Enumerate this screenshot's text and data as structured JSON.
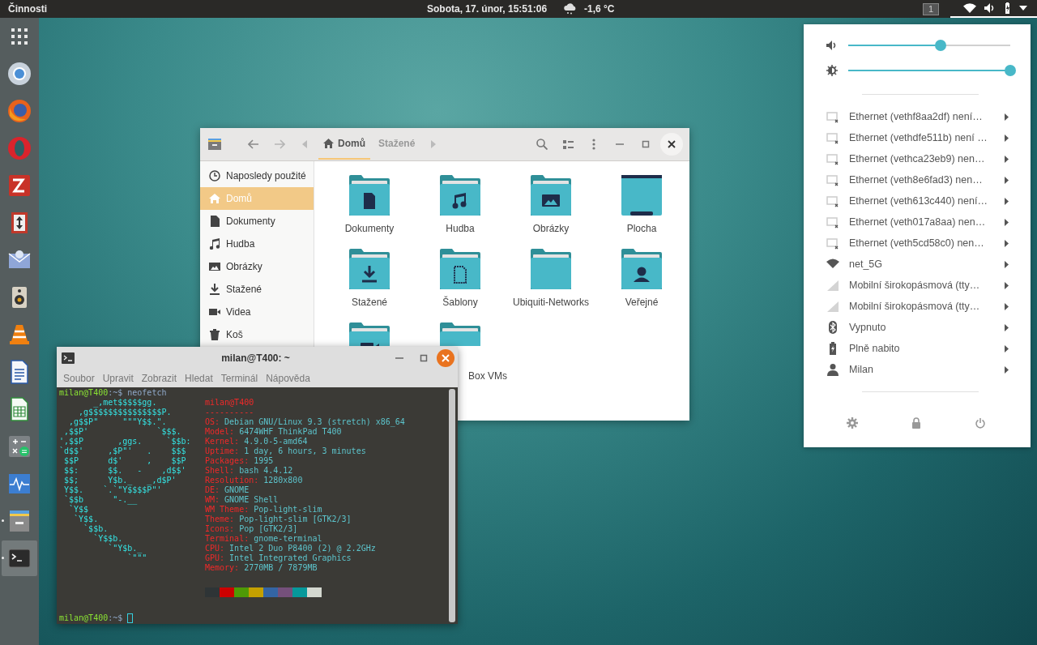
{
  "top_bar": {
    "activities": "Činnosti",
    "clock": "Sobota, 17. únor, 15:51:06",
    "weather": "-1,6 °C",
    "workspace": "1",
    "menu_open": true
  },
  "dock": [
    {
      "kind": "apps",
      "running": false,
      "selected": false
    },
    {
      "kind": "chrome",
      "running": false,
      "selected": false
    },
    {
      "kind": "firefox",
      "running": false,
      "selected": false
    },
    {
      "kind": "opera",
      "running": false,
      "selected": false
    },
    {
      "kind": "filezilla",
      "running": false,
      "selected": false
    },
    {
      "kind": "updown",
      "running": false,
      "selected": false
    },
    {
      "kind": "mail",
      "running": false,
      "selected": false
    },
    {
      "kind": "speaker",
      "running": false,
      "selected": false
    },
    {
      "kind": "vlc",
      "running": false,
      "selected": false
    },
    {
      "kind": "writer",
      "running": false,
      "selected": false
    },
    {
      "kind": "calc",
      "running": false,
      "selected": false
    },
    {
      "kind": "calculator",
      "running": false,
      "selected": false
    },
    {
      "kind": "monitor",
      "running": false,
      "selected": false
    },
    {
      "kind": "files",
      "running": true,
      "selected": false
    },
    {
      "kind": "terminal",
      "running": true,
      "selected": true
    }
  ],
  "files": {
    "path": [
      {
        "label": "Domů",
        "selected": true
      },
      {
        "label": "Stažené",
        "selected": false
      }
    ],
    "sidebar": [
      {
        "kind": "recent",
        "label": "Naposledy použité",
        "selected": false
      },
      {
        "kind": "home",
        "label": "Domů",
        "selected": true
      },
      {
        "kind": "doc",
        "label": "Dokumenty",
        "selected": false
      },
      {
        "kind": "music",
        "label": "Hudba",
        "selected": false
      },
      {
        "kind": "picture",
        "label": "Obrázky",
        "selected": false
      },
      {
        "kind": "download",
        "label": "Stažené",
        "selected": false
      },
      {
        "kind": "video",
        "label": "Videa",
        "selected": false
      },
      {
        "kind": "trash",
        "label": "Koš",
        "selected": false
      }
    ],
    "items": [
      {
        "kind": "doc",
        "label": "Dokumenty"
      },
      {
        "kind": "music",
        "label": "Hudba"
      },
      {
        "kind": "picture",
        "label": "Obrázky"
      },
      {
        "kind": "desktop",
        "label": "Plocha"
      },
      {
        "kind": "download",
        "label": "Stažené"
      },
      {
        "kind": "template",
        "label": "Šablony"
      },
      {
        "kind": "plain",
        "label": "Ubiquiti-Networks"
      },
      {
        "kind": "public",
        "label": "Veřejné"
      },
      {
        "kind": "video"
      },
      {
        "kind": "plain",
        "label": "Box VMs"
      }
    ]
  },
  "terminal": {
    "title": "milan@T400: ~",
    "menu": [
      "Soubor",
      "Upravit",
      "Zobrazit",
      "Hledat",
      "Terminál",
      "Nápověda"
    ],
    "prompts": [
      {
        "user": "milan@T400",
        "path": ":~$",
        "command": "neofetch"
      },
      {
        "user": "milan@T400",
        "path": ":~$"
      }
    ],
    "art": [
      "       _,met$$$$$gg.",
      "    ,g$$$$$$$$$$$$$$$P.",
      "  ,g$$P\"     \"\"\"Y$$.\".",
      " ,$$P'              `$$$.",
      "',$$P       ,ggs.     `$$b:",
      "`d$$'     ,$P\"'   .    $$$",
      " $$P      d$'     ,    $$P",
      " $$:      $$.   -    ,d$$'",
      " $$;      Y$b._   _,d$P'",
      " Y$$.    `.`\"Y$$$$P\"'",
      " `$$b      \"-.__",
      "  `Y$$",
      "   `Y$$.",
      "     `$$b.",
      "       `Y$$b.",
      "          `\"Y$b._",
      "              `\"\"\""
    ],
    "info_title": "milan@T400",
    "info_rule": "----------",
    "info": [
      {
        "key": "OS:",
        "value": "Debian GNU/Linux 9.3 (stretch) x86_64"
      },
      {
        "key": "Model:",
        "value": "6474WHF ThinkPad T400"
      },
      {
        "key": "Kernel:",
        "value": "4.9.0-5-amd64"
      },
      {
        "key": "Uptime:",
        "value": "1 day, 6 hours, 3 minutes"
      },
      {
        "key": "Packages:",
        "value": "1995"
      },
      {
        "key": "Shell:",
        "value": "bash 4.4.12"
      },
      {
        "key": "Resolution:",
        "value": "1280x800"
      },
      {
        "key": "DE:",
        "value": "GNOME"
      },
      {
        "key": "WM:",
        "value": "GNOME Shell"
      },
      {
        "key": "WM Theme:",
        "value": "Pop-light-slim"
      },
      {
        "key": "Theme:",
        "value": "Pop-light-slim [GTK2/3]"
      },
      {
        "key": "Icons:",
        "value": "Pop [GTK2/3]"
      },
      {
        "key": "Terminal:",
        "value": "gnome-terminal"
      },
      {
        "key": "CPU:",
        "value": "Intel 2 Duo P8400 (2) @ 2.2GHz"
      },
      {
        "key": "GPU:",
        "value": "Intel Integrated Graphics"
      },
      {
        "key": "Memory:",
        "value": "2770MB / 7879MB"
      }
    ],
    "palette": [
      {
        "color": "#2e3436"
      },
      {
        "color": "#cc0000"
      },
      {
        "color": "#4e9a06"
      },
      {
        "color": "#c4a000"
      },
      {
        "color": "#3465a4"
      },
      {
        "color": "#75507b"
      },
      {
        "color": "#06989a"
      },
      {
        "color": "#d3d7cf"
      }
    ]
  },
  "system_menu": {
    "sliders": [
      {
        "kind": "volume",
        "level": 0.57
      },
      {
        "kind": "brightness",
        "level": 1
      }
    ],
    "items": [
      {
        "kind": "wired",
        "label": "Ethernet (vethf8aa2df) není…"
      },
      {
        "kind": "wired",
        "label": "Ethernet (vethdfe511b) není …"
      },
      {
        "kind": "wired",
        "label": "Ethernet (vethca23eb9) nen…"
      },
      {
        "kind": "wired",
        "label": "Ethernet (veth8e6fad3) nen…"
      },
      {
        "kind": "wired",
        "label": "Ethernet (veth613c440) není…"
      },
      {
        "kind": "wired",
        "label": "Ethernet (veth017a8aa) nen…"
      },
      {
        "kind": "wired",
        "label": "Ethernet (veth5cd58c0) nen…"
      },
      {
        "kind": "wifi",
        "label": "net_5G"
      },
      {
        "kind": "cell",
        "label": "Mobilní širokopásmová (tty…"
      },
      {
        "kind": "cell",
        "label": "Mobilní širokopásmová (tty…"
      },
      {
        "kind": "bluetooth",
        "label": "Vypnuto"
      },
      {
        "kind": "battery",
        "label": "Plně nabito"
      },
      {
        "kind": "user",
        "label": "Milan"
      }
    ],
    "actions": [
      {
        "kind": "settings"
      },
      {
        "kind": "lock"
      },
      {
        "kind": "power"
      }
    ]
  }
}
